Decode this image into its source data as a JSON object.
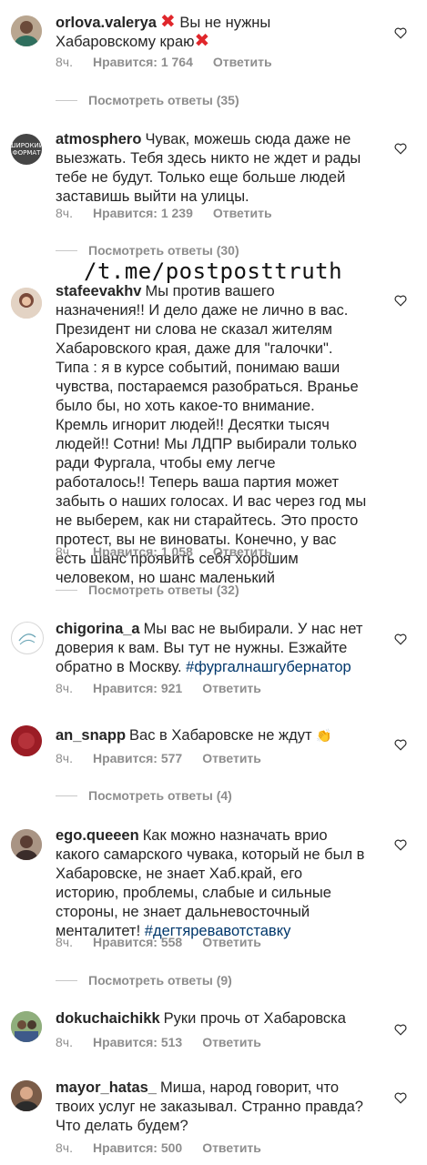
{
  "watermark": "/t.me/postposttruth",
  "labels": {
    "likes_prefix": "Нравится:",
    "reply": "Ответить"
  },
  "comments": [
    {
      "username": "orlova.valerya",
      "text_a": " Вы не нужны Хабаровскому краю",
      "time": "8ч.",
      "likes": "Нравится: 1 764",
      "reply": "Ответить",
      "view_replies": "Посмотреть ответы (35)"
    },
    {
      "username": "atmosphero",
      "avatar_text": "ШИРОКИЙ ФОРМАТ",
      "text": "Чувак, можешь сюда даже не выезжать. Тебя здесь никто не ждет и рады тебе не будут. Только еще больше людей заставишь выйти на улицы.",
      "time": "8ч.",
      "likes": "Нравится: 1 239",
      "reply": "Ответить",
      "view_replies": "Посмотреть ответы (30)"
    },
    {
      "username": "stafeevakhv",
      "text": "Мы против вашего назначения!! И дело даже не лично в вас. Президент ни слова не сказал жителям Хабаровского края, даже для \"галочки\". Типа : я в курсе событий, понимаю ваши чувства, постараемся разобраться. Вранье было бы, но хоть какое-то внимание. Кремль игнорит людей!! Десятки тысяч людей!! Сотни! Мы ЛДПР выбирали только ради Фургала, чтобы ему легче работалось!! Теперь ваша партия может забыть о наших голосах. И вас через год мы не выберем, как ни старайтесь. Это просто протест, вы не виноваты. Конечно, у вас есть шанс проявить себя хорошим человеком, но шанс маленький",
      "time": "8ч.",
      "likes": "Нравится: 1 058",
      "reply": "Ответить",
      "view_replies": "Посмотреть ответы (32)"
    },
    {
      "username": "chigorina_a",
      "text": "Мы вас не выбирали. У нас нет доверия к вам. Вы тут не нужны. Езжайте обратно в Москву.",
      "hashtag": "#фургалнашгубернатор",
      "time": "8ч.",
      "likes": "Нравится: 921",
      "reply": "Ответить"
    },
    {
      "username": "an_snapp",
      "text": "Вас в Хабаровске не ждут",
      "time": "8ч.",
      "likes": "Нравится: 577",
      "reply": "Ответить",
      "view_replies": "Посмотреть ответы (4)"
    },
    {
      "username": "ego.queeen",
      "text": "Как можно назначать врио какого самарского чувака, который не был в Хабаровске, не знает Хаб.край, его историю, проблемы, слабые и сильные стороны, не знает дальневосточный менталитет!",
      "hashtag": "#дегтяревавотставку",
      "time": "8ч.",
      "likes": "Нравится: 558",
      "reply": "Ответить",
      "view_replies": "Посмотреть ответы (9)"
    },
    {
      "username": "dokuchaichikk",
      "text": "Руки прочь от Хабаровска",
      "time": "8ч.",
      "likes": "Нравится: 513",
      "reply": "Ответить"
    },
    {
      "username": "mayor_hatas_",
      "text": "Миша, народ говорит, что твоих услуг не заказывал. Странно правда? Что делать будем?",
      "time": "8ч.",
      "likes": "Нравится: 500",
      "reply": "Ответить"
    }
  ]
}
